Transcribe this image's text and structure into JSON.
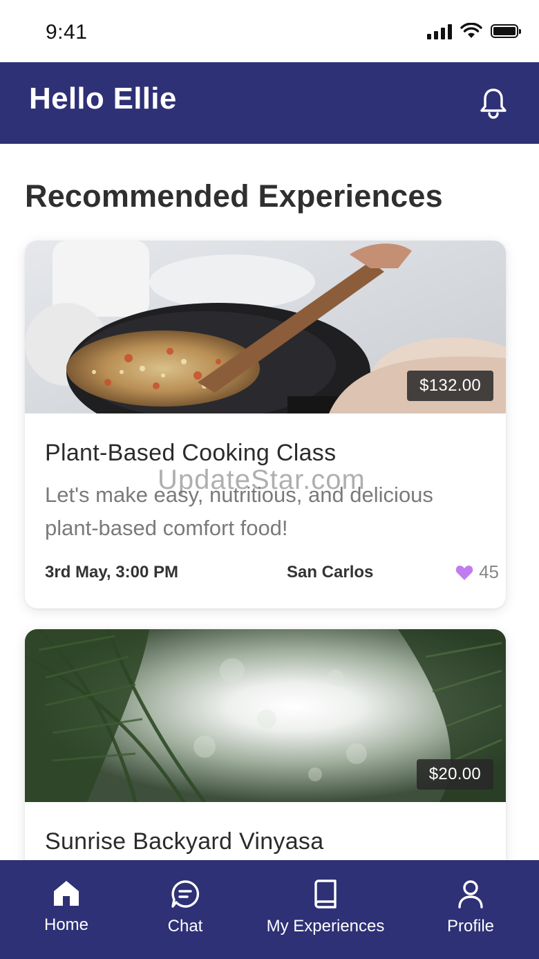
{
  "status_bar": {
    "time": "9:41"
  },
  "header": {
    "greeting": "Hello Ellie",
    "notification_icon": "bell-icon"
  },
  "section": {
    "title": "Recommended Experiences"
  },
  "experiences": [
    {
      "title": "Plant-Based Cooking Class",
      "description": "Let's make easy, nutritious, and delicious plant-based comfort food!",
      "price": "$132.00",
      "date": "3rd May, 3:00 PM",
      "location": "San Carlos",
      "likes": "45",
      "image": "cooking-pan-photo"
    },
    {
      "title": "Sunrise Backyard Vinyasa",
      "price": "$20.00",
      "image": "palm-leaves-sunrise-photo"
    }
  ],
  "watermark": "UpdateStar.com",
  "nav": {
    "items": [
      {
        "label": "Home",
        "icon": "home-icon"
      },
      {
        "label": "Chat",
        "icon": "chat-icon"
      },
      {
        "label": "My Experiences",
        "icon": "book-icon"
      },
      {
        "label": "Profile",
        "icon": "user-icon"
      }
    ]
  },
  "colors": {
    "primary": "#2e3176",
    "like_heart": "#c17df0",
    "price_tag": "#2c2c2c"
  }
}
